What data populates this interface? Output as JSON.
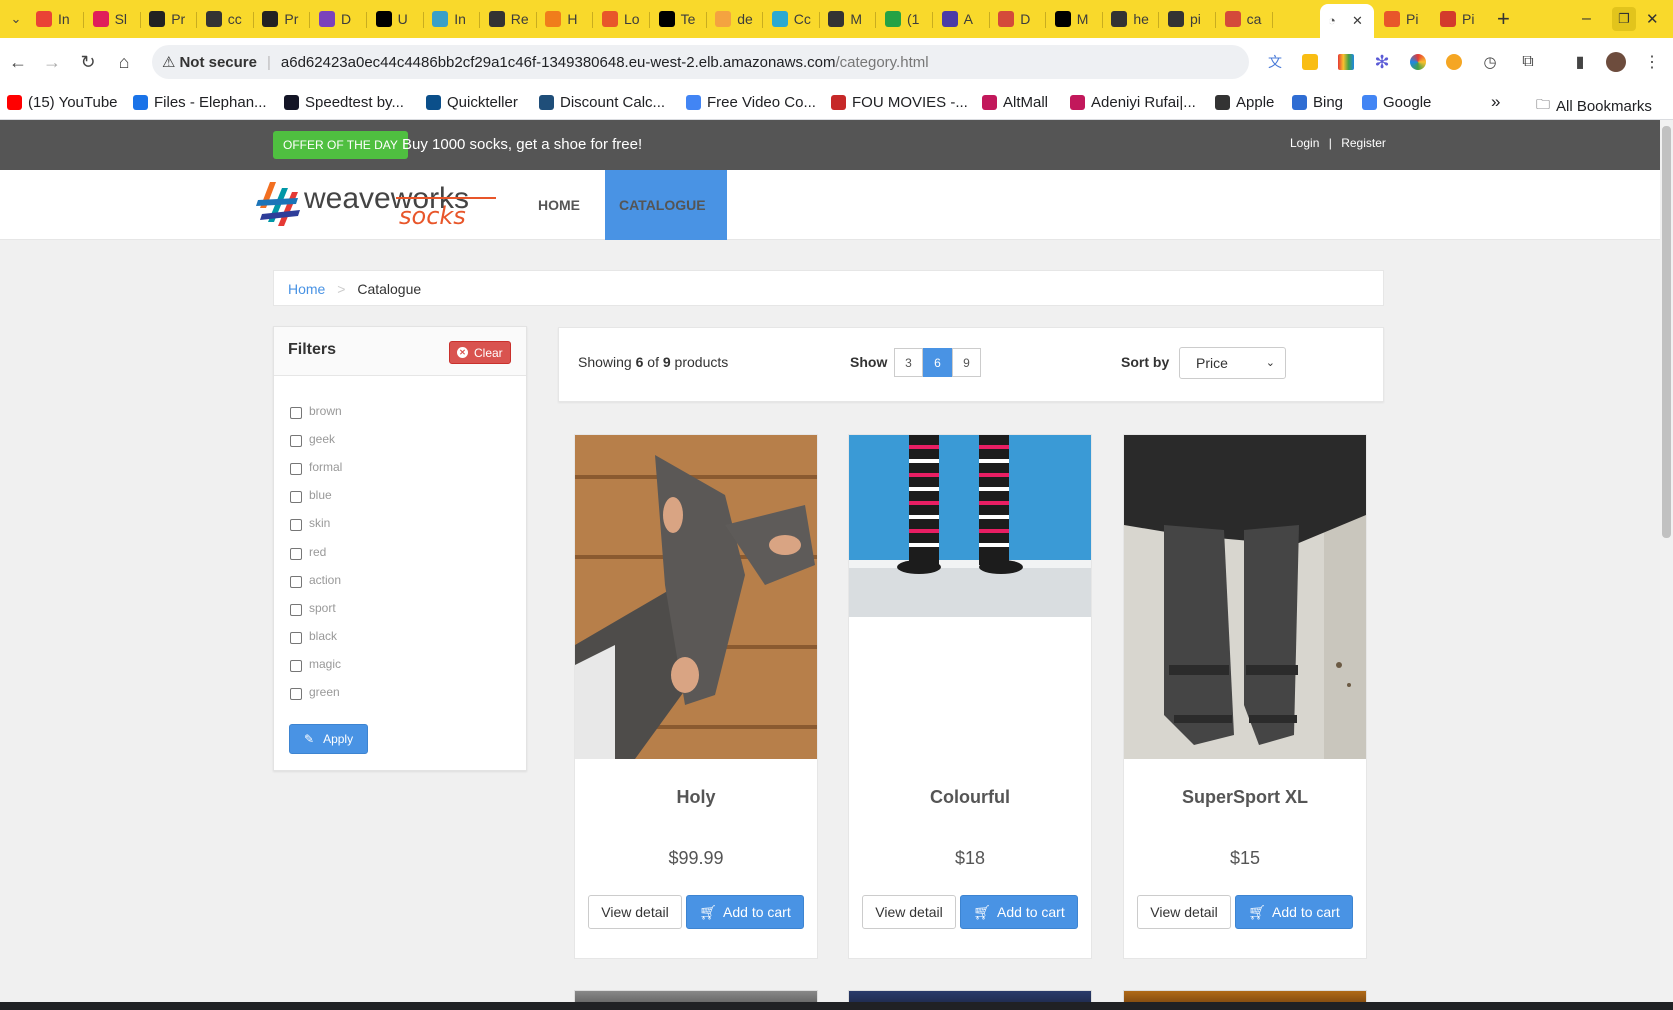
{
  "browser": {
    "tabs": [
      {
        "label": "In",
        "color": "#ea4335"
      },
      {
        "label": "Sl",
        "color": "#e01e5a"
      },
      {
        "label": "Pr",
        "color": "#222222"
      },
      {
        "label": "cc",
        "color": "#333333"
      },
      {
        "label": "Pr",
        "color": "#222222"
      },
      {
        "label": "D",
        "color": "#7b42bc"
      },
      {
        "label": "U",
        "color": "#000000"
      },
      {
        "label": "In",
        "color": "#3aa0c8"
      },
      {
        "label": "Re",
        "color": "#333333"
      },
      {
        "label": "H",
        "color": "#f07d1b"
      },
      {
        "label": "Lo",
        "color": "#e8562a"
      },
      {
        "label": "Te",
        "color": "#000000"
      },
      {
        "label": "de",
        "color": "#f4a340"
      },
      {
        "label": "Cc",
        "color": "#2aa9d2"
      },
      {
        "label": "M",
        "color": "#333333"
      },
      {
        "label": "(1",
        "color": "#25a244"
      },
      {
        "label": "A",
        "color": "#4b3ca7"
      },
      {
        "label": "D",
        "color": "#d44a3a"
      },
      {
        "label": "M",
        "color": "#000000"
      },
      {
        "label": "he",
        "color": "#333333"
      },
      {
        "label": "pi",
        "color": "#333333"
      },
      {
        "label": "ca",
        "color": "#d44a3a"
      }
    ],
    "active_tab_close": "✕",
    "after_tabs": [
      {
        "label": "Pi",
        "color": "#e8562a"
      },
      {
        "label": "Pi",
        "color": "#d33b2c"
      }
    ],
    "new_tab": "+",
    "security_label": "Not secure",
    "url_host": "a6d62423a0ec44c4486bb2cf29a1c46f-1349380648.eu-west-2.elb.amazonaws.com",
    "url_path": "/category.html",
    "bookmarks": [
      {
        "label": "(15) YouTube",
        "color": "#ff0000"
      },
      {
        "label": "Files - Elephan...",
        "color": "#1a73e8"
      },
      {
        "label": "Speedtest by...",
        "color": "#141526"
      },
      {
        "label": "Quickteller",
        "color": "#0b4f8a"
      },
      {
        "label": "Discount Calc...",
        "color": "#1f4e79"
      },
      {
        "label": "Free Video Co...",
        "color": "#4285f4"
      },
      {
        "label": "FOU MOVIES -...",
        "color": "#c62828"
      },
      {
        "label": "AltMall",
        "color": "#c2185b"
      },
      {
        "label": "Adeniyi Rufai|...",
        "color": "#c2185b"
      },
      {
        "label": "Apple",
        "color": "#333333"
      },
      {
        "label": "Bing",
        "color": "#2f6dd3"
      },
      {
        "label": "Google",
        "color": "#4285f4"
      }
    ],
    "bookmarks_overflow": "»",
    "all_bookmarks": "All Bookmarks"
  },
  "topbar": {
    "offer_badge": "OFFER OF THE DAY",
    "offer_text": "Buy 1000 socks, get a shoe for free!",
    "login": "Login",
    "separator": "|",
    "register": "Register"
  },
  "nav": {
    "logo_main": "weaveworks",
    "logo_sub": "socks",
    "home": "HOME",
    "catalogue": "CATALOGUE"
  },
  "breadcrumb": {
    "home": "Home",
    "sep": ">",
    "current": "Catalogue"
  },
  "filters": {
    "title": "Filters",
    "clear": "Clear",
    "apply": "Apply",
    "tags": [
      "brown",
      "geek",
      "formal",
      "blue",
      "skin",
      "red",
      "action",
      "sport",
      "black",
      "magic",
      "green"
    ]
  },
  "listing": {
    "showing_prefix": "Showing",
    "shown": "6",
    "of": "of",
    "total": "9",
    "suffix": "products",
    "show_label": "Show",
    "page_sizes": [
      "3",
      "6",
      "9"
    ],
    "selected_page_size": "6",
    "sort_label": "Sort by",
    "sort_value": "Price"
  },
  "products": [
    {
      "name": "Holy",
      "price": "$99.99",
      "view": "View detail",
      "cart": "Add to cart"
    },
    {
      "name": "Colourful",
      "price": "$18",
      "view": "View detail",
      "cart": "Add to cart"
    },
    {
      "name": "SuperSport XL",
      "price": "$15",
      "view": "View detail",
      "cart": "Add to cart"
    }
  ],
  "colors": {
    "accent": "#4993e4",
    "offer": "#4fbf40",
    "danger": "#d9534f",
    "tabstrip": "#f9d92b",
    "topbar": "#555555"
  }
}
